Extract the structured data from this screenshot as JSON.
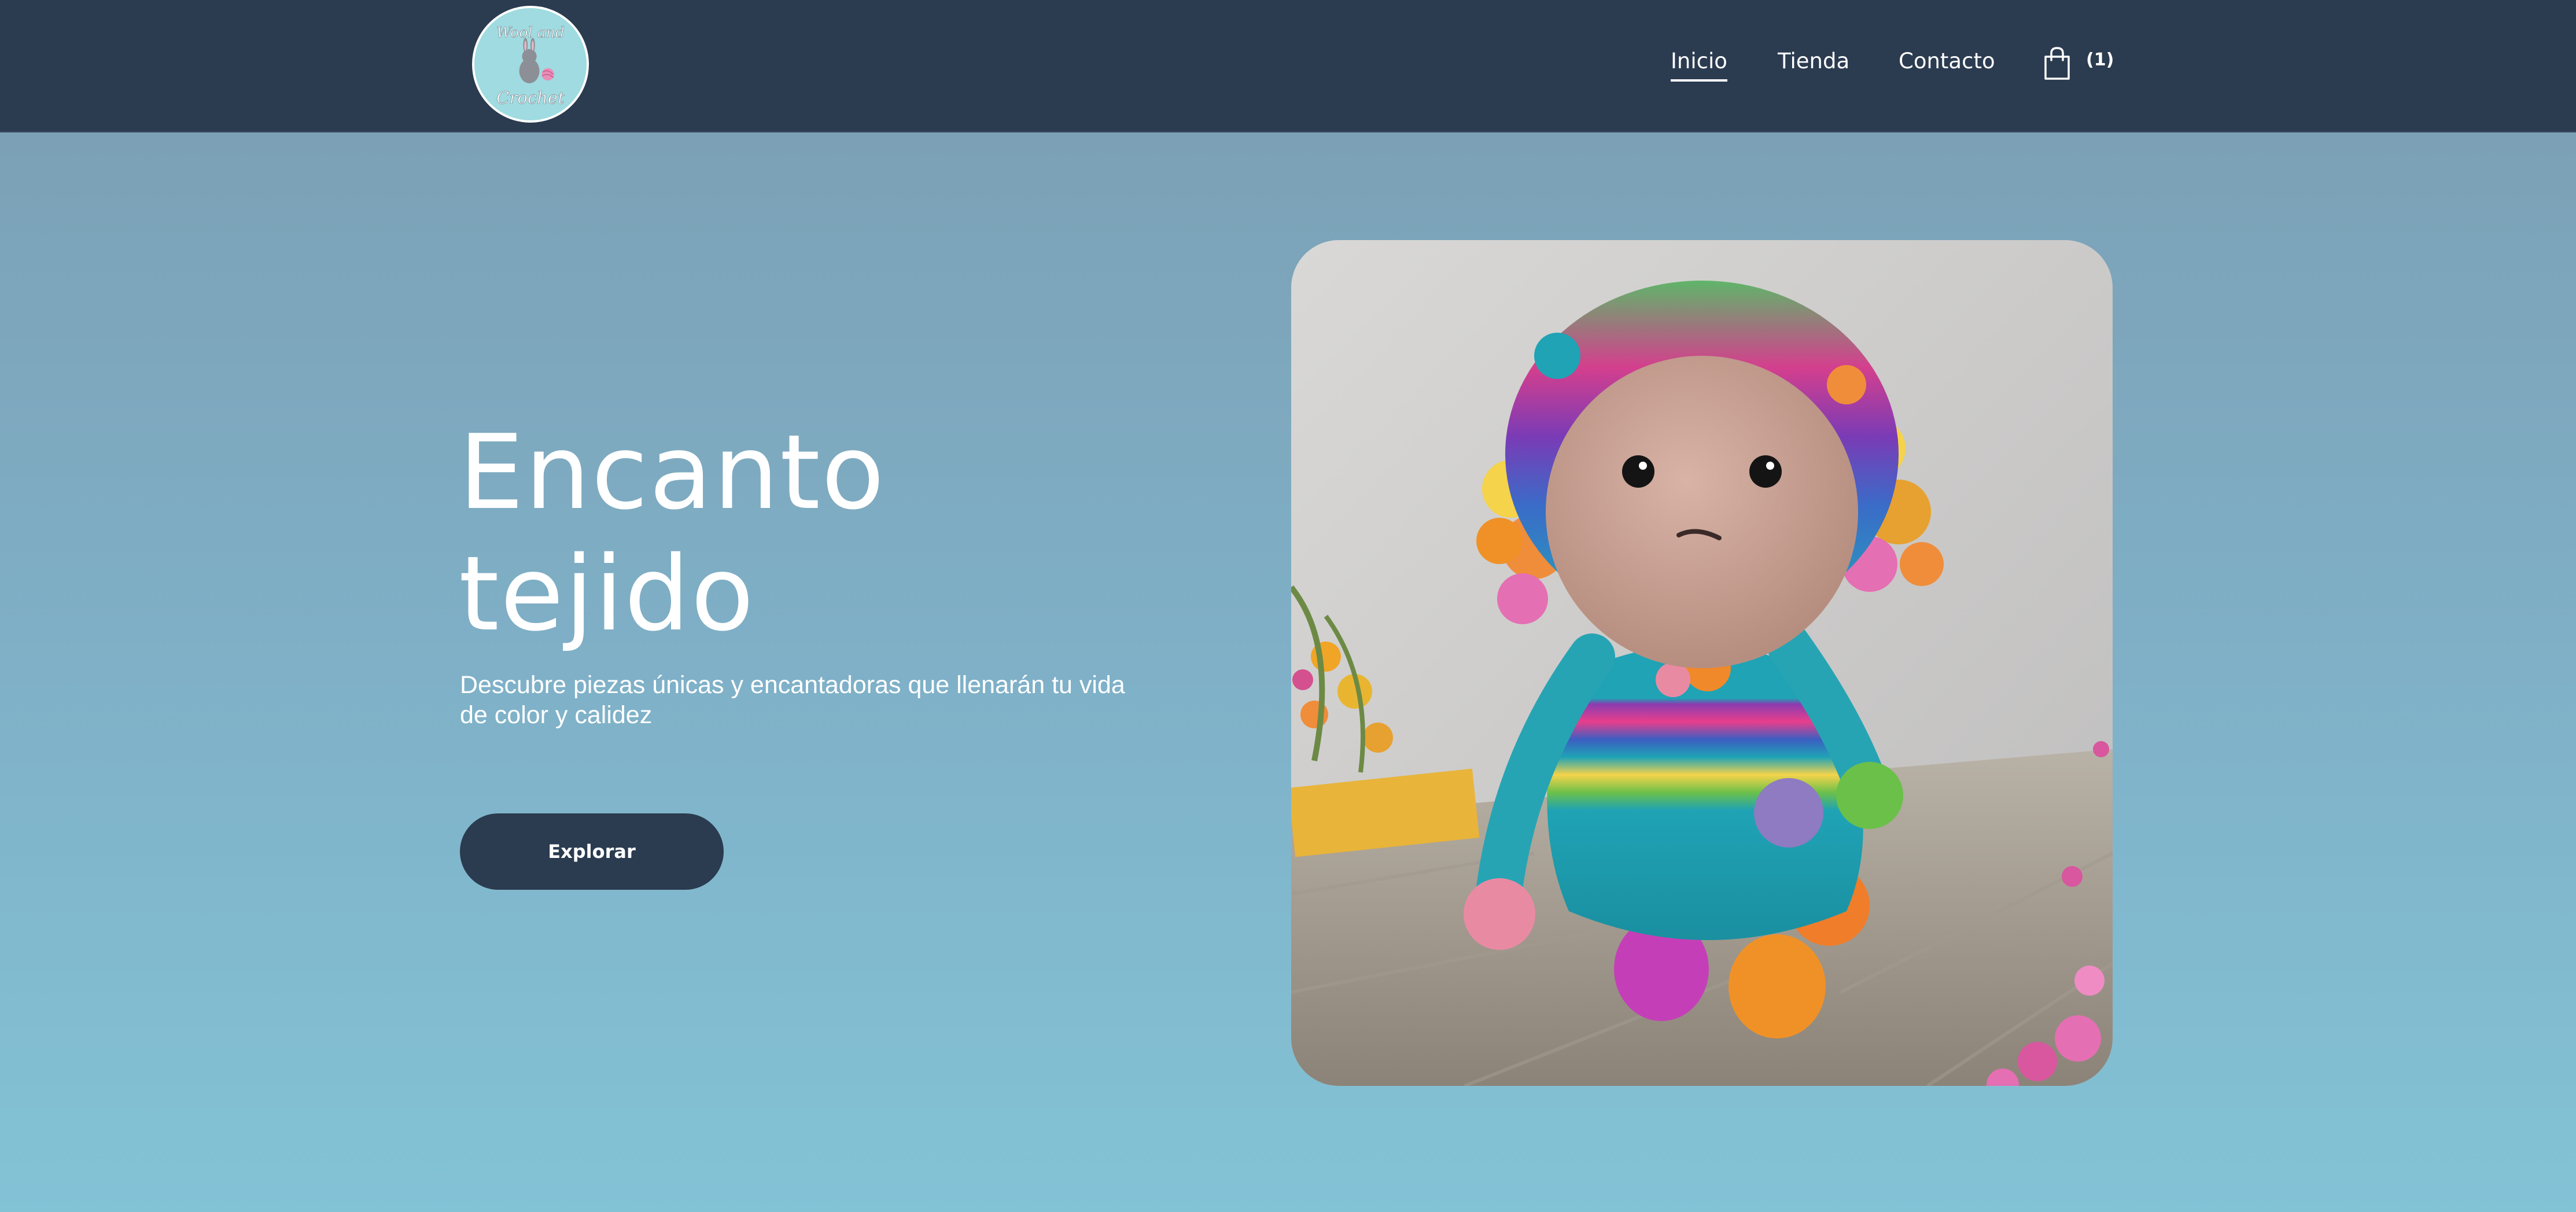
{
  "brand": {
    "logo_text_top": "Wool and",
    "logo_text_bottom": "Crochet",
    "logo_icon": "bunny-icon"
  },
  "nav": {
    "items": [
      {
        "label": "Inicio",
        "active": true
      },
      {
        "label": "Tienda",
        "active": false
      },
      {
        "label": "Contacto",
        "active": false
      }
    ],
    "cart_icon": "shopping-bag-icon",
    "cart_count": "(1)"
  },
  "hero": {
    "title_line1": "Encanto",
    "title_line2": "tejido",
    "subtitle": "Descubre piezas únicas y encantadoras que llenarán tu vida de color y calidez",
    "cta_label": "Explorar",
    "image_subject": "crochet-doll-illustration"
  },
  "colors": {
    "header_bg": "#2b3b50",
    "button_bg": "#2b3b50",
    "page_gradient_top": "#7b9db2",
    "page_gradient_bottom": "#83c3d6",
    "logo_bg": "#9fdbe0",
    "text": "#ffffff"
  }
}
